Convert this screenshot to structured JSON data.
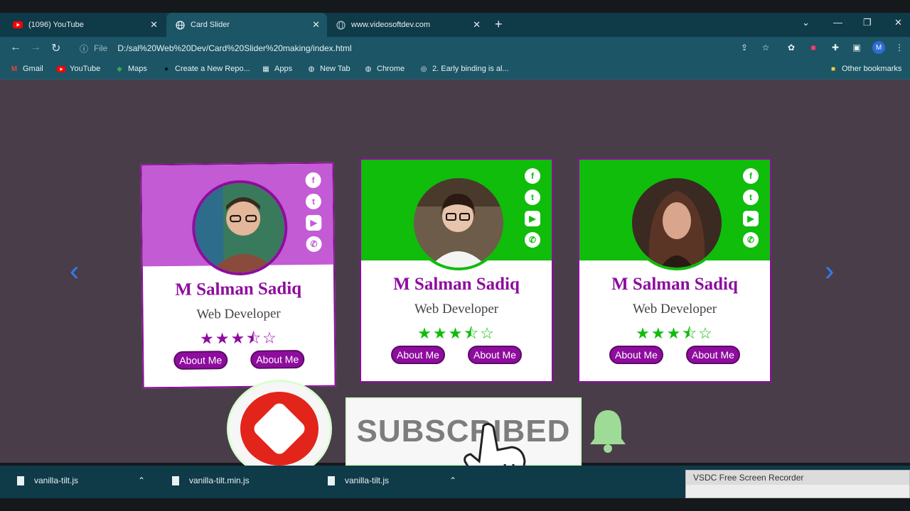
{
  "tabs": [
    {
      "title": "(1096) YouTube"
    },
    {
      "title": "Card Slider"
    },
    {
      "title": "www.videosoftdev.com"
    }
  ],
  "address": {
    "scheme": "File",
    "url": "D:/sal%20Web%20Dev/Card%20Slider%20making/index.html"
  },
  "bookmarks": [
    {
      "label": "Gmail"
    },
    {
      "label": "YouTube"
    },
    {
      "label": "Maps"
    },
    {
      "label": "Create a New Repo..."
    },
    {
      "label": "Apps"
    },
    {
      "label": "New Tab"
    },
    {
      "label": "Chrome"
    },
    {
      "label": "2. Early binding is al..."
    },
    {
      "label": "Other bookmarks"
    }
  ],
  "profile_initial": "M",
  "cards": [
    {
      "name": "M Salman Sadiq",
      "role": "Web Developer",
      "rating": 3.5,
      "btn1": "About Me",
      "btn2": "About Me"
    },
    {
      "name": "M Salman Sadiq",
      "role": "Web Developer",
      "rating": 3.5,
      "btn1": "About Me",
      "btn2": "About Me"
    },
    {
      "name": "M Salman Sadiq",
      "role": "Web Developer",
      "rating": 3.5,
      "btn1": "About Me",
      "btn2": "About Me"
    }
  ],
  "subscribe": {
    "label": "SUBSCRIBED"
  },
  "downloads": [
    {
      "file": "vanilla-tilt.js"
    },
    {
      "file": "vanilla-tilt.min.js"
    },
    {
      "file": "vanilla-tilt.js"
    }
  ],
  "recorder": {
    "title": "VSDC Free Screen Recorder"
  },
  "colors": {
    "accent": "#8e0c9e",
    "green": "#0fbd0a",
    "pink": "#c35bd4",
    "page_bg": "#4a3d4a"
  }
}
